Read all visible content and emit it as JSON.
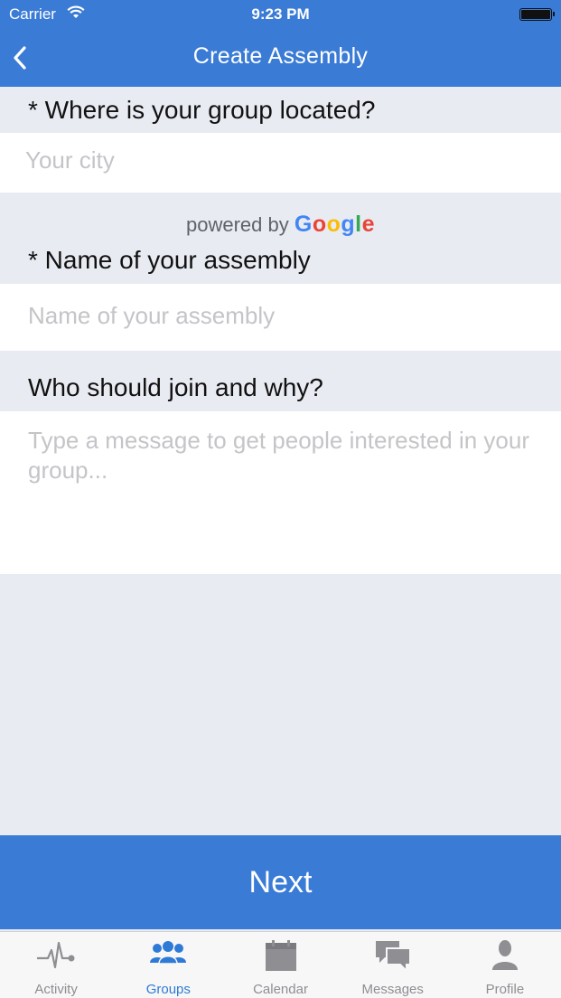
{
  "status_bar": {
    "carrier": "Carrier",
    "time": "9:23 PM"
  },
  "header": {
    "title": "Create Assembly",
    "back_icon": "chevron-left-icon"
  },
  "form": {
    "location_label": "* Where is your group located?",
    "location_placeholder": "Your city",
    "powered_by_text": "powered by",
    "google_letters": [
      "G",
      "o",
      "o",
      "g",
      "l",
      "e"
    ],
    "name_label": "* Name of your assembly",
    "name_placeholder": "Name of your assembly",
    "description_label": "Who should join and why?",
    "description_placeholder": "Type a message to get people interested in your group..."
  },
  "next_button": {
    "label": "Next"
  },
  "tabs": [
    {
      "label": "Activity",
      "icon": "activity-pulse-icon",
      "active": false
    },
    {
      "label": "Groups",
      "icon": "groups-icon",
      "active": true
    },
    {
      "label": "Calendar",
      "icon": "calendar-icon",
      "active": false
    },
    {
      "label": "Messages",
      "icon": "messages-icon",
      "active": false
    },
    {
      "label": "Profile",
      "icon": "profile-icon",
      "active": false
    }
  ],
  "colors": {
    "primary": "#3a7bd5",
    "background": "#e9ebf2",
    "tab_active": "#2f7ad6",
    "tab_inactive": "#8e8e93"
  }
}
